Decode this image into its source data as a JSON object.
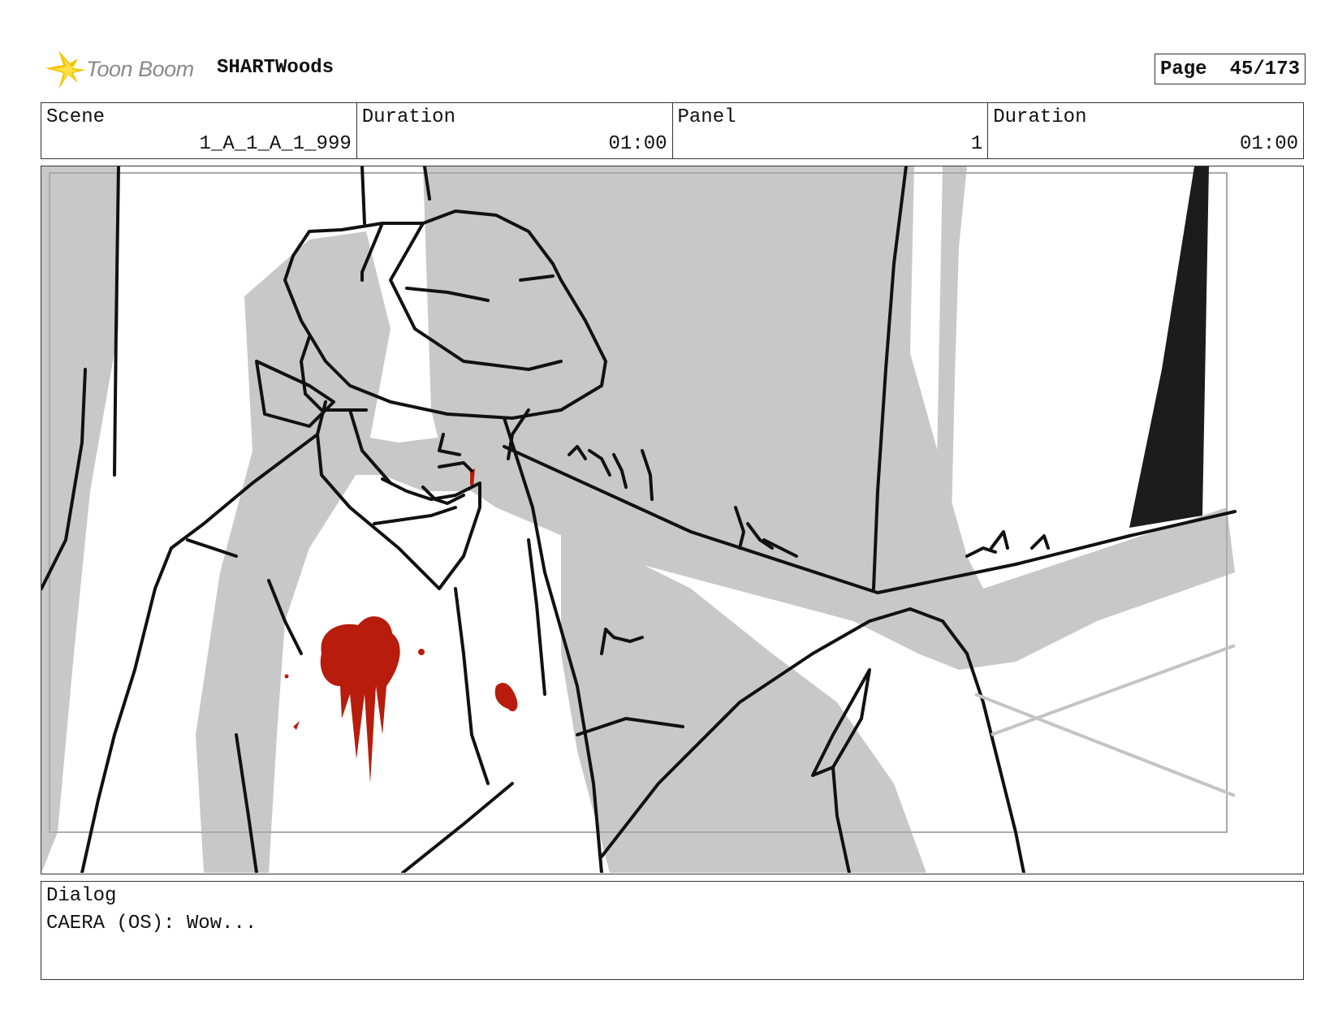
{
  "header": {
    "logo_text": "Toon Boom",
    "project_title": "SHARTWoods",
    "page_label": "Page",
    "page_number": "45/173"
  },
  "info": {
    "scene_label": "Scene",
    "scene_value": "1_A_1_A_1_999",
    "scene_duration_label": "Duration",
    "scene_duration_value": "01:00",
    "panel_label": "Panel",
    "panel_value": "1",
    "panel_duration_label": "Duration",
    "panel_duration_value": "01:00"
  },
  "dialog": {
    "label": "Dialog",
    "text": "CAERA (OS): Wow..."
  },
  "colors": {
    "ink": "#111111",
    "shade": "#c8c8c8",
    "blood": "#b81c0c",
    "logo_yellow": "#f5c400",
    "logo_gray": "#8a8a8a"
  }
}
